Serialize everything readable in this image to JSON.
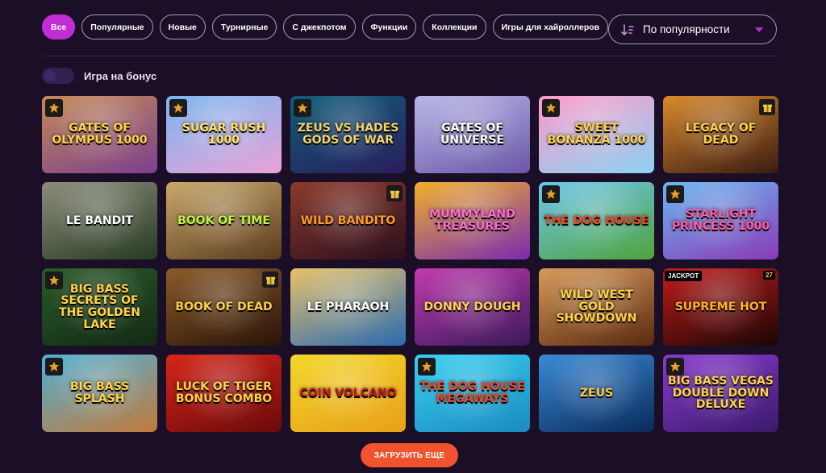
{
  "filters": [
    {
      "label": "Все",
      "active": true
    },
    {
      "label": "Популярные",
      "active": false
    },
    {
      "label": "Новые",
      "active": false
    },
    {
      "label": "Турнирные",
      "active": false
    },
    {
      "label": "С джекпотом",
      "active": false
    },
    {
      "label": "Функции",
      "active": false
    },
    {
      "label": "Коллекции",
      "active": false
    },
    {
      "label": "Игры для хайроллеров",
      "active": false
    }
  ],
  "sort": {
    "label": "По популярности",
    "icon": "sort-descending-icon"
  },
  "bonus_toggle": {
    "label": "Игра на бонус",
    "on": false
  },
  "games": [
    {
      "title": "Gates of Olympus 1000",
      "bg1": "#c48a55",
      "bg2": "#7d3f8f",
      "text": "#ffd24a",
      "provider": true,
      "gift": false
    },
    {
      "title": "Sugar Rush 1000",
      "bg1": "#7ab6f0",
      "bg2": "#e9a2d8",
      "text": "#ffe36a",
      "provider": true,
      "gift": false
    },
    {
      "title": "Zeus vs Hades Gods of War",
      "bg1": "#0e5e7a",
      "bg2": "#2a1d5c",
      "text": "#f2d46b",
      "provider": true,
      "gift": false
    },
    {
      "title": "Gates of Universe",
      "bg1": "#b9b7e6",
      "bg2": "#6a57a8",
      "text": "#ffffff",
      "provider": false,
      "gift": false
    },
    {
      "title": "Sweet Bonanza 1000",
      "bg1": "#ff9ac8",
      "bg2": "#8cd1f2",
      "text": "#ffd24a",
      "provider": true,
      "gift": false
    },
    {
      "title": "Legacy of Dead",
      "bg1": "#d98a2c",
      "bg2": "#3a1b12",
      "text": "#ffcf4a",
      "provider": false,
      "gift": true
    },
    {
      "title": "Le Bandit",
      "bg1": "#8c8c7c",
      "bg2": "#263b22",
      "text": "#ffffff",
      "provider": false,
      "gift": false
    },
    {
      "title": "Book of Time",
      "bg1": "#c9a96a",
      "bg2": "#5a3a1e",
      "text": "#bff24a",
      "provider": false,
      "gift": false
    },
    {
      "title": "Wild Bandito",
      "bg1": "#8c3a2a",
      "bg2": "#2b0f1e",
      "text": "#ff9b2a",
      "provider": false,
      "gift": true
    },
    {
      "title": "Mummyland Treasures",
      "bg1": "#f0b02a",
      "bg2": "#7a2ab0",
      "text": "#ff6ad0",
      "provider": false,
      "gift": false
    },
    {
      "title": "The Dog House",
      "bg1": "#6ec6f0",
      "bg2": "#4fa33a",
      "text": "#e84a2a",
      "provider": true,
      "gift": false
    },
    {
      "title": "Starlight Princess 1000",
      "bg1": "#6ab8f0",
      "bg2": "#8a3ab8",
      "text": "#ff5aa8",
      "provider": true,
      "gift": false
    },
    {
      "title": "Big Bass Secrets of the Golden Lake",
      "bg1": "#2b5a2a",
      "bg2": "#122a14",
      "text": "#ffd24a",
      "provider": true,
      "gift": false
    },
    {
      "title": "Book of Dead",
      "bg1": "#8a5a2a",
      "bg2": "#2a1408",
      "text": "#ffcf4a",
      "provider": false,
      "gift": true
    },
    {
      "title": "Le Pharaoh",
      "bg1": "#e8c26a",
      "bg2": "#2a6ab0",
      "text": "#ffffff",
      "provider": false,
      "gift": false
    },
    {
      "title": "Donny Dough",
      "bg1": "#c23ab0",
      "bg2": "#3a1a5a",
      "text": "#ffd24a",
      "provider": false,
      "gift": false
    },
    {
      "title": "Wild West Gold Showdown",
      "bg1": "#d89a5a",
      "bg2": "#5a2a10",
      "text": "#ffd24a",
      "provider": false,
      "gift": false
    },
    {
      "title": "Supreme Hot",
      "bg1": "#c21a1a",
      "bg2": "#1a0606",
      "text": "#ffb02a",
      "provider": false,
      "gift": false,
      "jackpot": "JACKPOT",
      "badge": "27"
    },
    {
      "title": "Big Bass Splash",
      "bg1": "#4fb0d8",
      "bg2": "#c27a3a",
      "text": "#ffd24a",
      "provider": true,
      "gift": false
    },
    {
      "title": "Luck of Tiger Bonus Combo",
      "bg1": "#d8261a",
      "bg2": "#6a0a0a",
      "text": "#ffd24a",
      "provider": false,
      "gift": false
    },
    {
      "title": "Coin Volcano",
      "bg1": "#f2d82a",
      "bg2": "#e8a01a",
      "text": "#c21a1a",
      "provider": false,
      "gift": false
    },
    {
      "title": "The Dog House Megaways",
      "bg1": "#3ad0f0",
      "bg2": "#1a8ac0",
      "text": "#e84a2a",
      "provider": true,
      "gift": false
    },
    {
      "title": "Zeus",
      "bg1": "#3a8ad8",
      "bg2": "#0a2a5a",
      "text": "#ffd24a",
      "provider": false,
      "gift": false
    },
    {
      "title": "Big Bass Vegas Double Down Deluxe",
      "bg1": "#8a3ad0",
      "bg2": "#3a1a6a",
      "text": "#ffd24a",
      "provider": true,
      "gift": false
    }
  ],
  "load_more": {
    "label": "ЗАГРУЗИТЬ ЕЩЕ"
  }
}
